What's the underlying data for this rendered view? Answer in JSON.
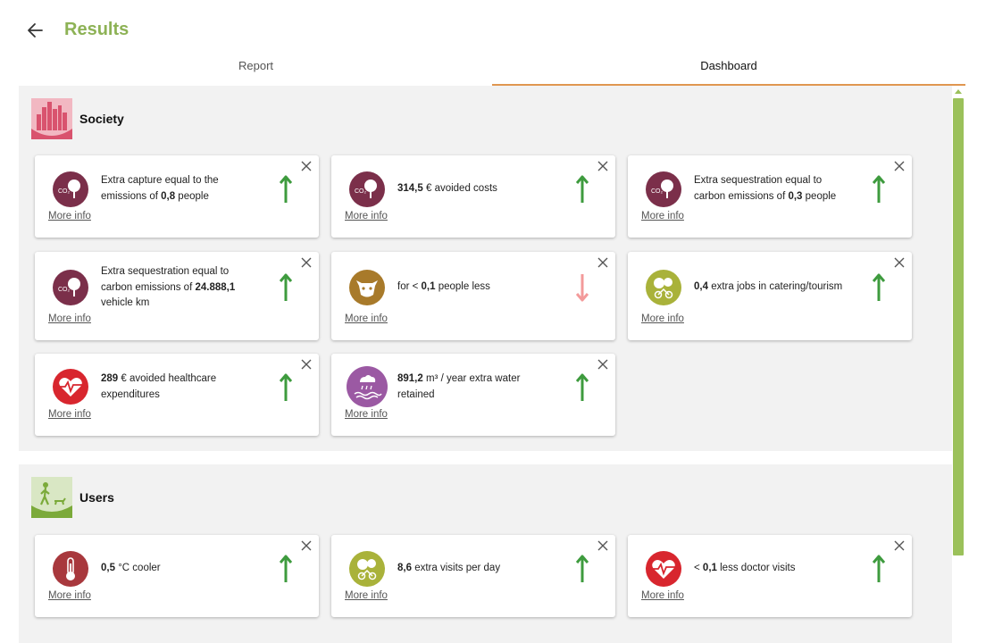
{
  "header": {
    "title": "Results"
  },
  "tabs": [
    {
      "label": "Report",
      "active": false
    },
    {
      "label": "Dashboard",
      "active": true
    }
  ],
  "colors": {
    "brand_green": "#8DB255",
    "tab_underline": "#E09650",
    "up_arrow": "#3E9B3E",
    "down_arrow": "#F39A9A"
  },
  "sections": [
    {
      "title": "Society",
      "icon": "city-skyline-icon",
      "cards": [
        {
          "pre": "Extra capture equal to the emissions of ",
          "value": "0,8",
          "post": " people",
          "more": "More info",
          "trend": "up",
          "icon": "co2-tree-icon"
        },
        {
          "pre": "",
          "value": "314,5",
          "post": " € avoided costs",
          "more": "More info",
          "trend": "up",
          "icon": "co2-tree-icon"
        },
        {
          "pre": "Extra sequestration equal to carbon emissions of ",
          "value": "0,3",
          "post": " people",
          "more": "More info",
          "trend": "up",
          "icon": "co2-tree-icon"
        },
        {
          "pre": "Extra sequestration equal to carbon emissions of ",
          "value": "24.888,1",
          "post": " vehicle km",
          "more": "More info",
          "trend": "up",
          "icon": "co2-tree-icon"
        },
        {
          "pre": "for < ",
          "value": "0,1",
          "post": " people less",
          "more": "More info",
          "trend": "down",
          "icon": "cow-icon"
        },
        {
          "pre": "",
          "value": "0,4",
          "post": " extra jobs in catering/tourism",
          "more": "More info",
          "trend": "up",
          "icon": "cyclist-tree-icon"
        },
        {
          "pre": "",
          "value": "289",
          "post": " € avoided healthcare expenditures",
          "more": "More info",
          "trend": "up",
          "icon": "heartbeat-icon"
        },
        {
          "pre": "",
          "value": "891,2",
          "post": " m³ / year extra water retained",
          "more": "More info",
          "trend": "up",
          "icon": "water-retention-icon"
        }
      ]
    },
    {
      "title": "Users",
      "icon": "walker-dog-icon",
      "cards": [
        {
          "pre": "",
          "value": "0,5",
          "post": " °C cooler",
          "more": "More info",
          "trend": "up",
          "icon": "thermometer-icon"
        },
        {
          "pre": "",
          "value": "8,6",
          "post": " extra visits per day",
          "more": "More info",
          "trend": "up",
          "icon": "cyclist-tree-icon"
        },
        {
          "pre": "< ",
          "value": "0,1",
          "post": " less doctor visits",
          "more": "More info",
          "trend": "up",
          "icon": "heartbeat-icon"
        }
      ]
    }
  ]
}
